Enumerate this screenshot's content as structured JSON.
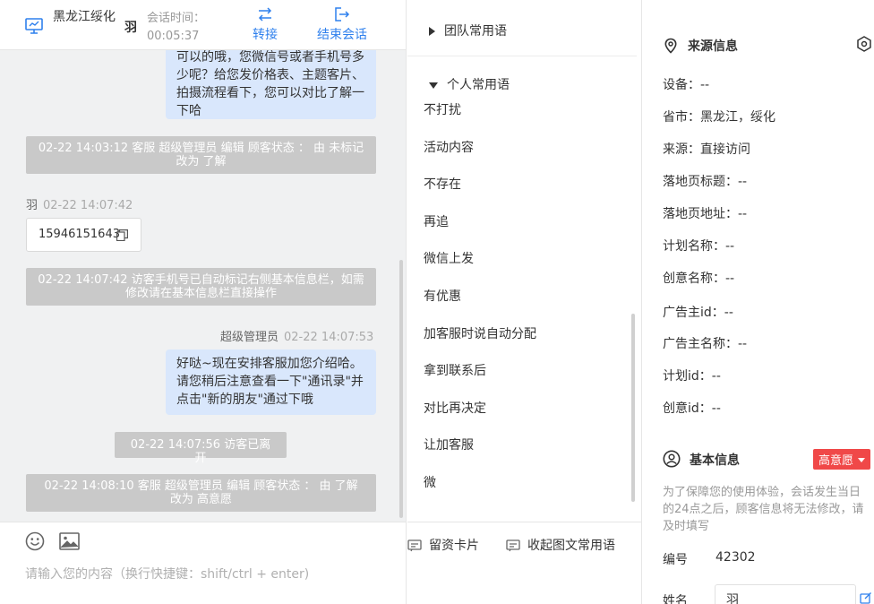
{
  "header": {
    "location": "黑龙江绥化",
    "visitor_name": "羽",
    "session_time_label": "会话时间：",
    "session_time": "00:05:37",
    "transfer_label": "转接",
    "end_session_label": "结束会话"
  },
  "messages": {
    "top_bubble": "可以的哦，您微信号或者手机号多少呢？给您发价格表、主题客片、拍摄流程看下，您可以对比了解一下哈",
    "sys_status_1": "02-22 14:03:12 客服 超级管理员 编辑 顾客状态 ： 由 未标记 改为 了解",
    "visitor_sender": "羽",
    "visitor_time": "02-22 14:07:42",
    "phone_number": "15946151643",
    "sys_phone_notice": "02-22 14:07:42 访客手机号已自动标记右侧基本信息栏，如需修改请在基本信息栏直接操作",
    "agent_sender": "超级管理员",
    "agent_time": "02-22 14:07:53",
    "agent_bubble": "好哒~现在安排客服加您介绍哈。请您稍后注意查看一下\"通讯录\"并点击\"新的朋友\"通过下哦",
    "sys_left": "02-22 14:07:56 访客已离开",
    "sys_status_2": "02-22 14:08:10 客服 超级管理员 编辑 顾客状态 ： 由 了解 改为 高意愿"
  },
  "input": {
    "placeholder": "请输入您的内容（换行快捷键：shift/ctrl + enter)"
  },
  "phrases": {
    "team_group": "团队常用语",
    "personal_group": "个人常用语",
    "items": [
      "不打扰",
      "活动内容",
      "不存在",
      "再追",
      "微信上发",
      "有优惠",
      "加客服时说自动分配",
      "拿到联系后",
      "对比再决定",
      "让加客服",
      "微"
    ],
    "card_label": "留资卡片",
    "collapse_label": "收起图文常用语"
  },
  "source_info": {
    "title": "来源信息",
    "device": "设备：--",
    "province_city": "省市：黑龙江，绥化",
    "source": "来源：直接访问",
    "landing_title": "落地页标题：--",
    "landing_url": "落地页地址：--",
    "plan_name": "计划名称：--",
    "creative_name": "创意名称：--",
    "advertiser_id": "广告主id：--",
    "advertiser_name": "广告主名称：--",
    "plan_id": "计划id：--",
    "creative_id": "创意id：--"
  },
  "basic_info": {
    "title": "基本信息",
    "intent_badge": "高意愿",
    "note": "为了保障您的使用体验，会话发生当日的24点之后，顾客信息将无法修改，请及时填写",
    "id_label": "编号",
    "id_value": "42302",
    "name_label": "姓名",
    "name_value": "羽"
  },
  "colors": {
    "accent": "#2f80ed",
    "bubble": "#d9e7fc",
    "system_notice": "#c9c9c9",
    "badge": "#f04848"
  }
}
